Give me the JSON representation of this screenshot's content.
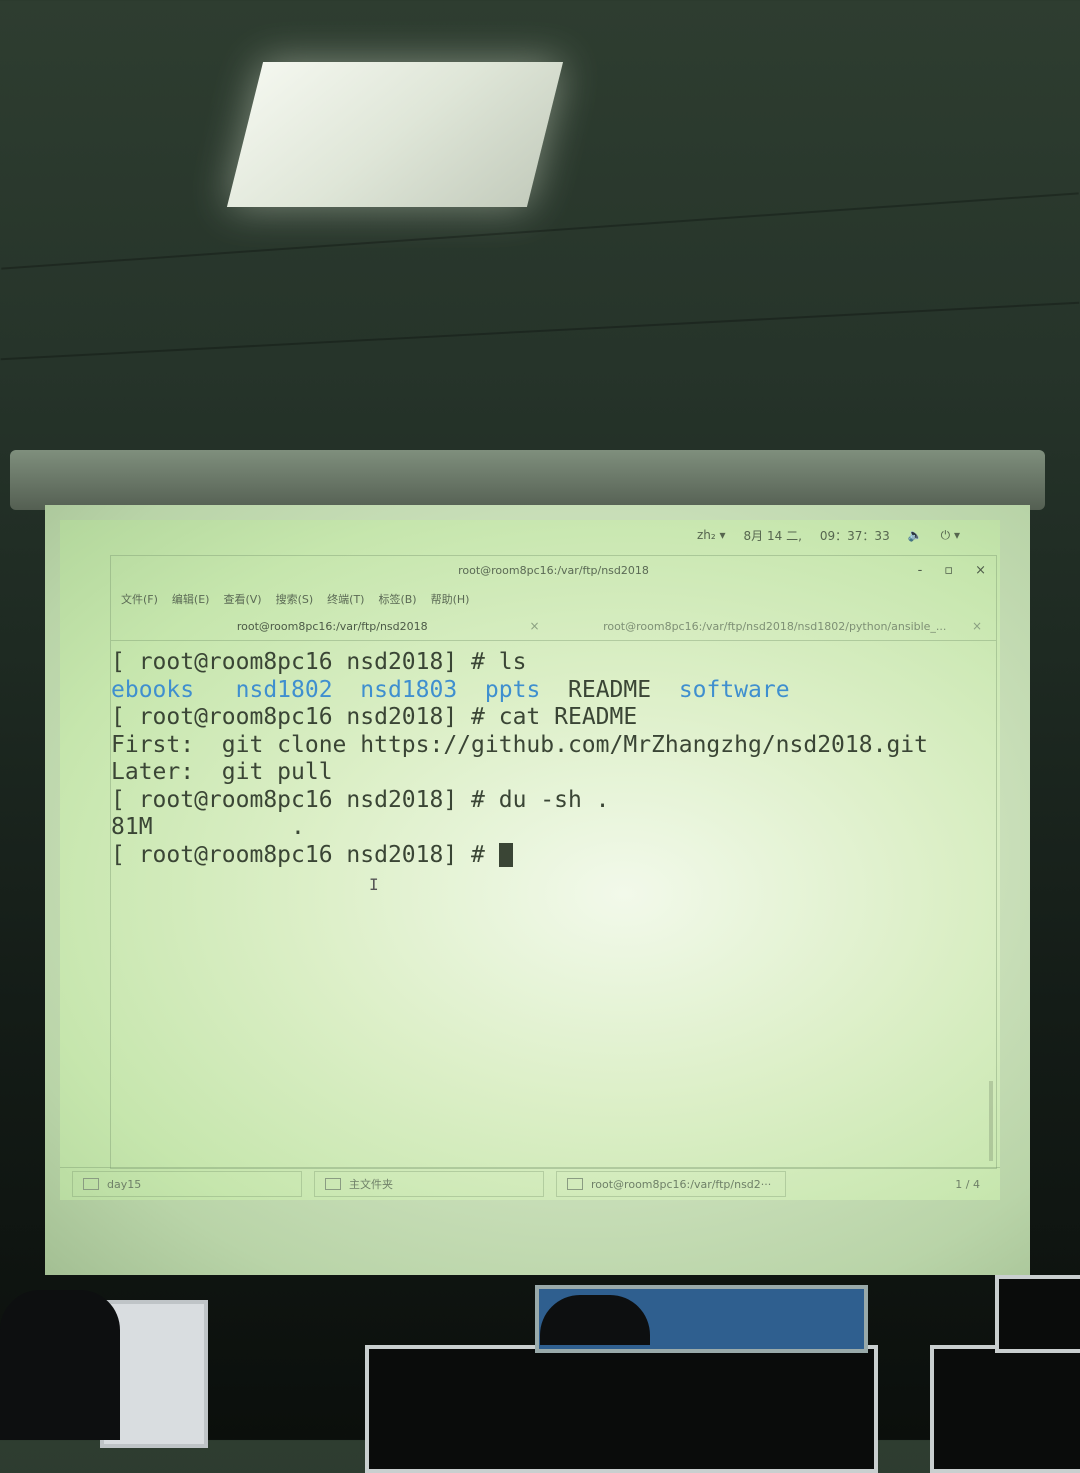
{
  "desktop": {
    "topbar": {
      "lang": "zh₂ ▾",
      "date": "8月 14 二,",
      "time": "09：37：33",
      "volume_icon": "speaker-icon",
      "power_icon": "power-icon"
    },
    "window": {
      "title": "root@room8pc16:/var/ftp/nsd2018",
      "controls": [
        "-",
        "▫",
        "×"
      ],
      "menus": [
        "文件(F)",
        "编辑(E)",
        "查看(V)",
        "搜索(S)",
        "终端(T)",
        "标签(B)",
        "帮助(H)"
      ],
      "tabs": [
        {
          "label": "root@room8pc16:/var/ftp/nsd2018",
          "close": "×"
        },
        {
          "label": "root@room8pc16:/var/ftp/nsd2018/nsd1802/python/ansible_...",
          "close": "×"
        }
      ]
    },
    "terminal": {
      "prompt": "[ root@room8pc16 nsd2018] #",
      "cmd_ls": "ls",
      "ls_output": {
        "dirs": [
          "ebooks",
          "nsd1802",
          "nsd1803",
          "ppts"
        ],
        "file": "README",
        "dir_last": "software"
      },
      "cmd_cat": "cat README",
      "readme_line1": "First:  git clone https://github.com/MrZhangzhg/nsd2018.git",
      "readme_line2": "Later:  git pull",
      "cmd_du": "du -sh .",
      "du_output": "81M          ."
    },
    "taskbar": {
      "tasks": [
        "day15",
        "主文件夹",
        "root@room8pc16:/var/ftp/nsd2···"
      ],
      "pager": "1 / 4"
    }
  },
  "colors": {
    "terminal_text": "#3a4535",
    "directory": "#3f8fcf",
    "projection_bg": "#dcefc7"
  }
}
